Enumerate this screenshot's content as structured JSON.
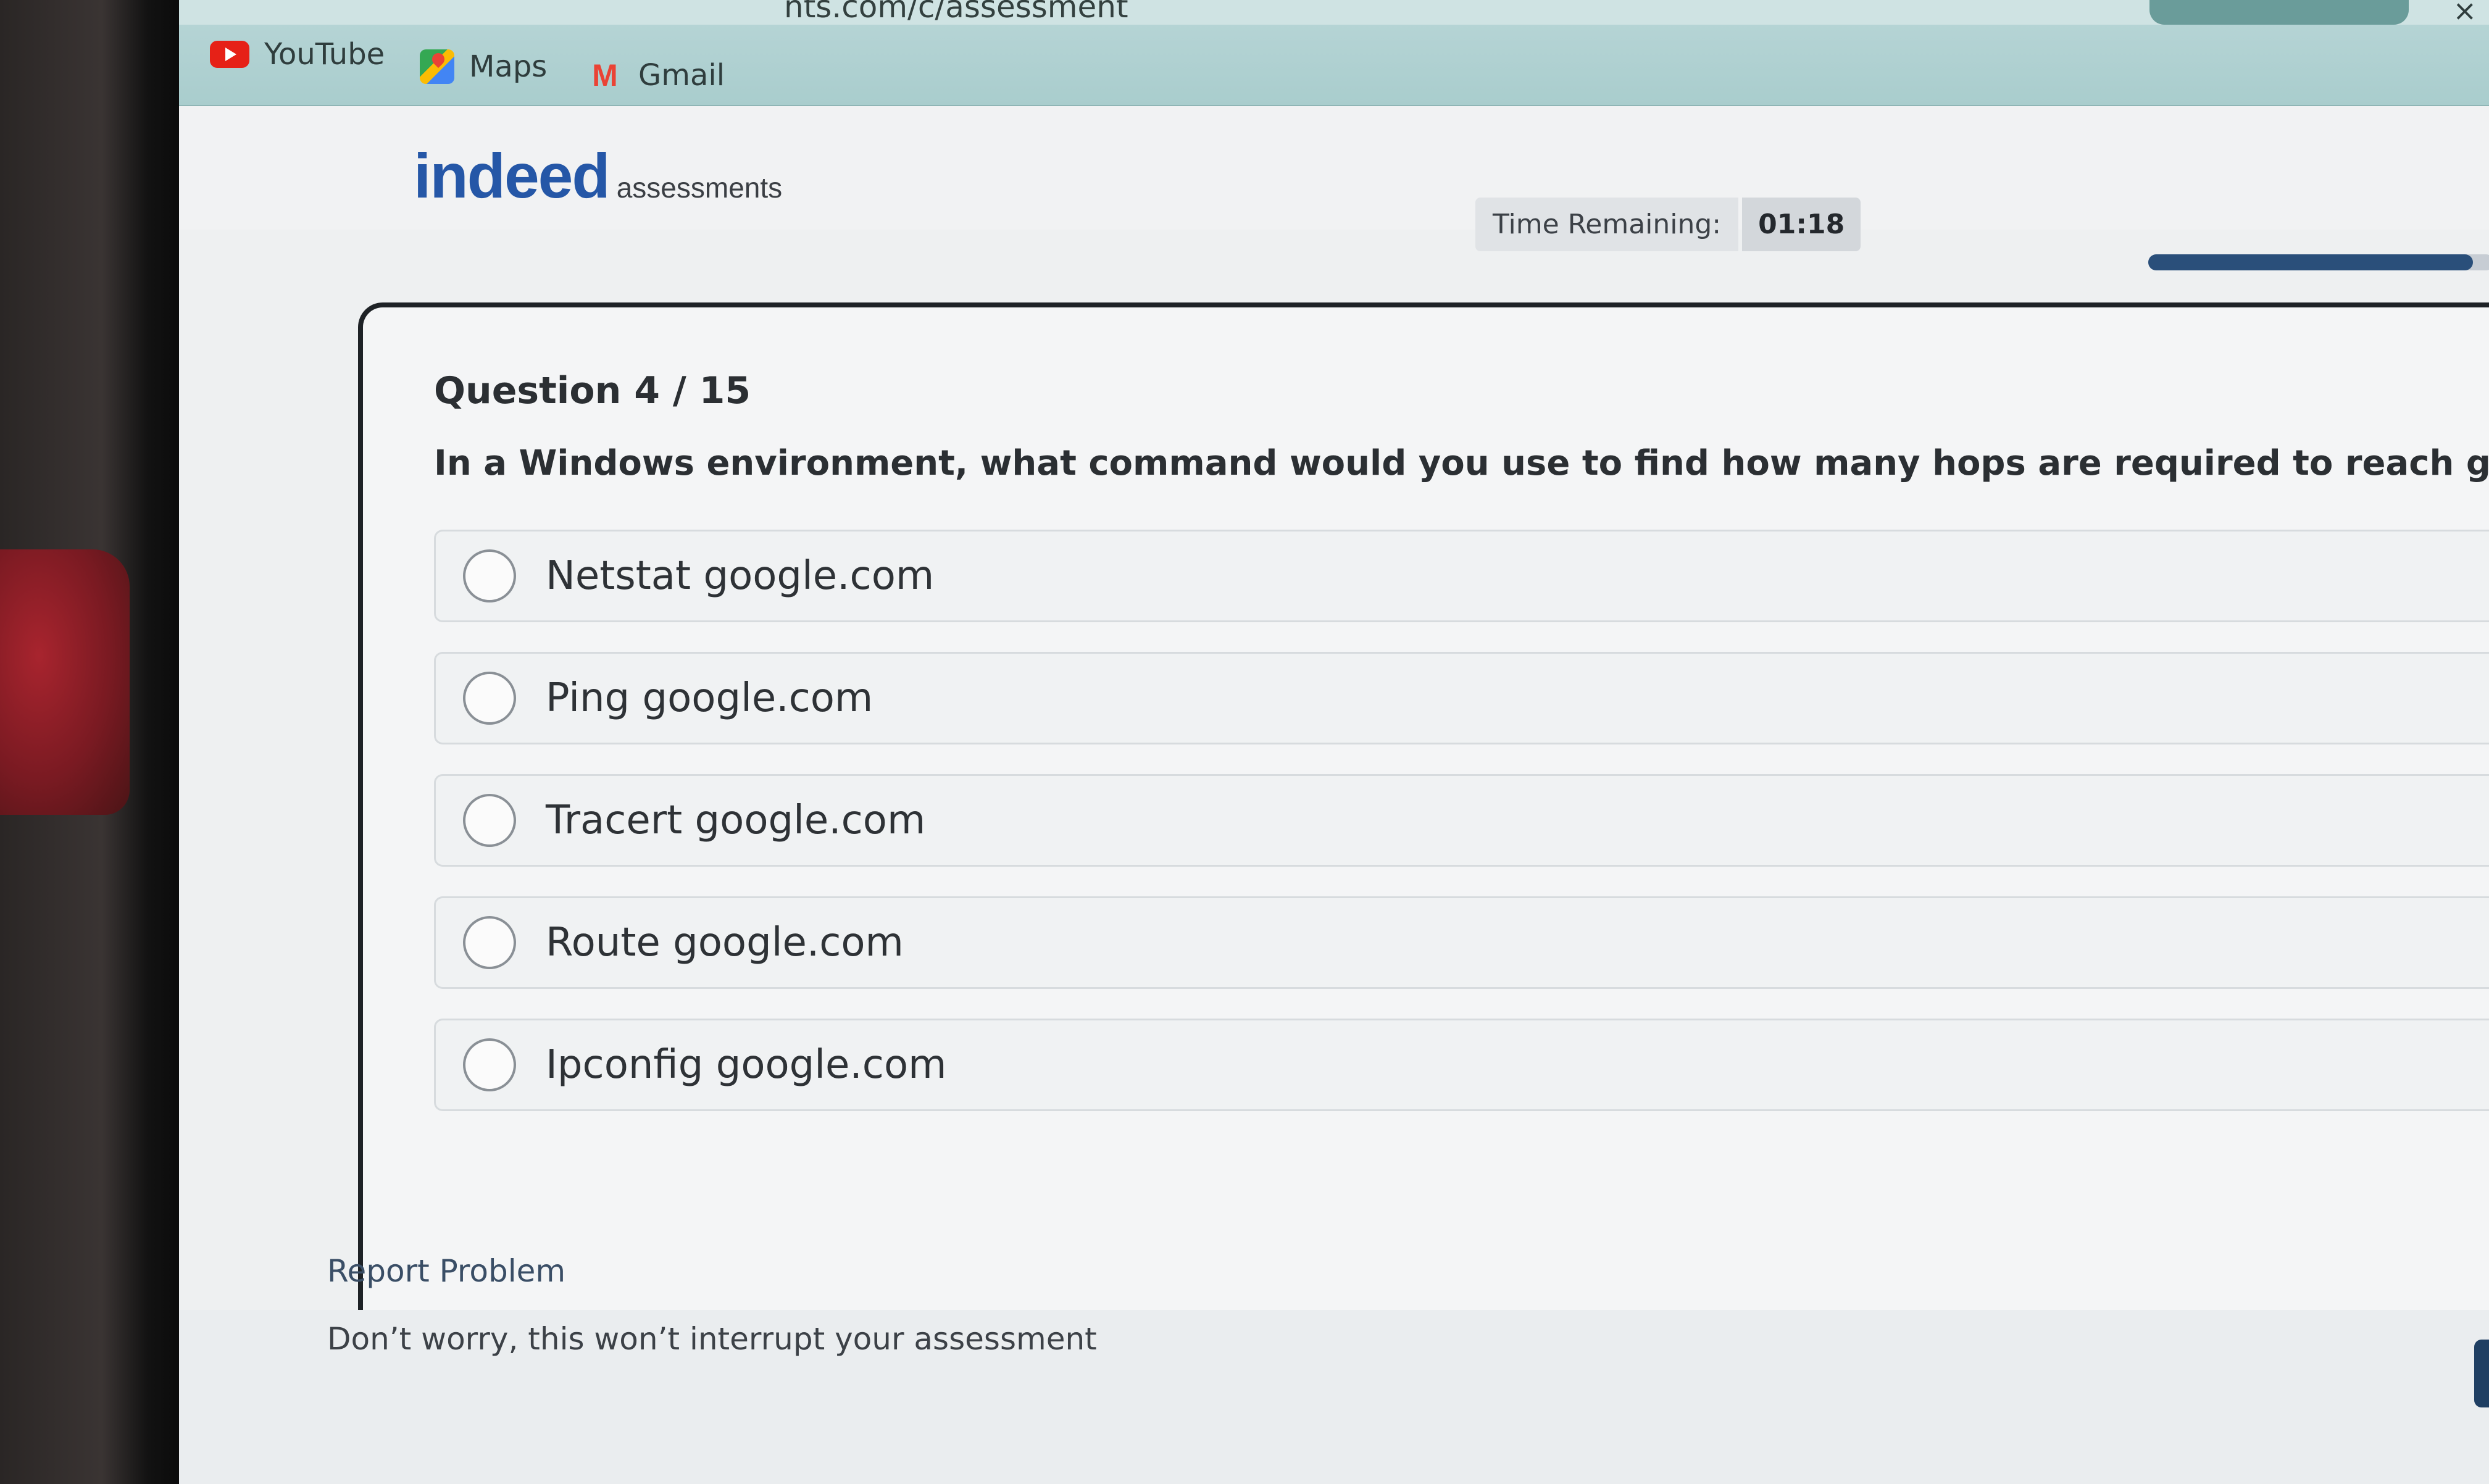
{
  "browser": {
    "url_fragment": "nts.com/c/assessment",
    "bookmarks": [
      {
        "label": "YouTube",
        "icon": "youtube-icon"
      },
      {
        "label": "Maps",
        "icon": "maps-icon"
      },
      {
        "label": "Gmail",
        "icon": "gmail-icon"
      }
    ]
  },
  "header": {
    "logo_main": "indeed",
    "logo_sub": "assessments",
    "timer_label": "Time Remaining:",
    "timer_value": "01:18",
    "progress_fraction": 0.94
  },
  "question": {
    "number_label": "Question 4 / 15",
    "text": "In a Windows environment, what command would you use to find how many hops are required to reach google.com?",
    "options": [
      {
        "label": "Netstat google.com"
      },
      {
        "label": "Ping google.com"
      },
      {
        "label": "Tracert google.com"
      },
      {
        "label": "Route google.com"
      },
      {
        "label": "Ipconfig google.com"
      }
    ]
  },
  "footer": {
    "report_label": "Report Problem",
    "report_note": "Don’t worry, this won’t interrupt your assessment"
  },
  "colors": {
    "brand": "#2557a7",
    "progress": "#2a4f7a",
    "bookmarks_bar": "#a9cdcd"
  }
}
